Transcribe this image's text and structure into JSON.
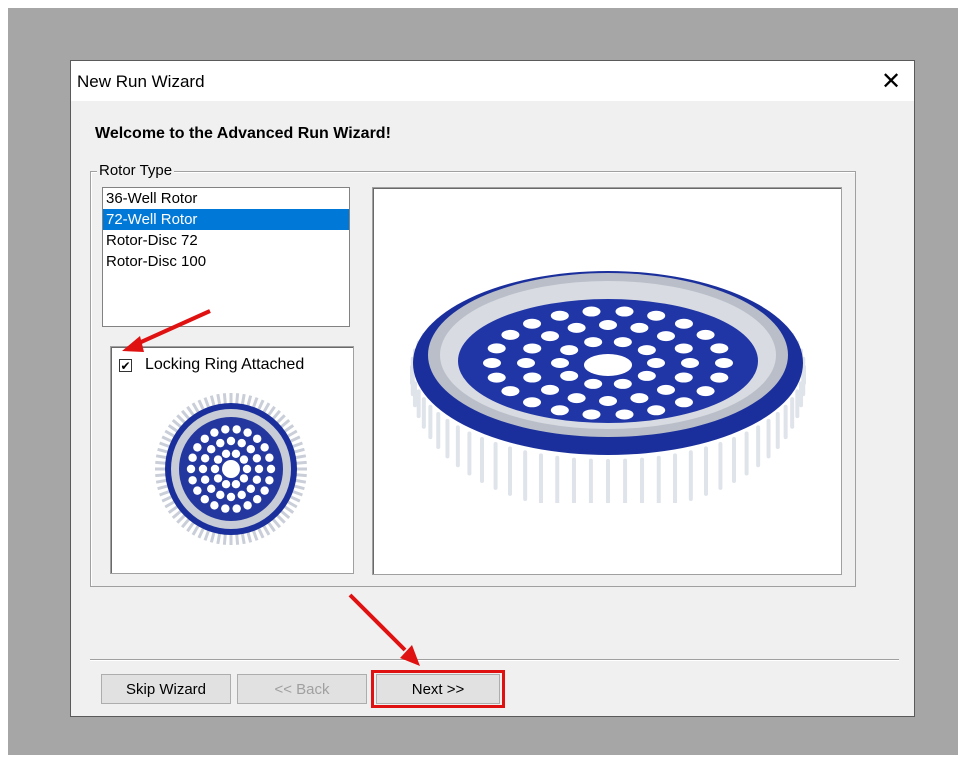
{
  "window": {
    "title": "New Run Wizard",
    "close_glyph": "✕"
  },
  "welcome_heading": "Welcome to the Advanced Run Wizard!",
  "rotor_type": {
    "group_label": "Rotor Type",
    "options": [
      "36-Well Rotor",
      "72-Well Rotor",
      "Rotor-Disc 72",
      "Rotor-Disc 100"
    ],
    "selected": "72-Well Rotor"
  },
  "locking_ring": {
    "label": "Locking Ring Attached",
    "checked": true
  },
  "buttons": {
    "skip": "Skip Wizard",
    "back": "<< Back",
    "next": "Next >>"
  },
  "colors": {
    "selection": "#0078d7",
    "rotor_blue": "#1a2f9c",
    "annotation": "#e01111"
  }
}
